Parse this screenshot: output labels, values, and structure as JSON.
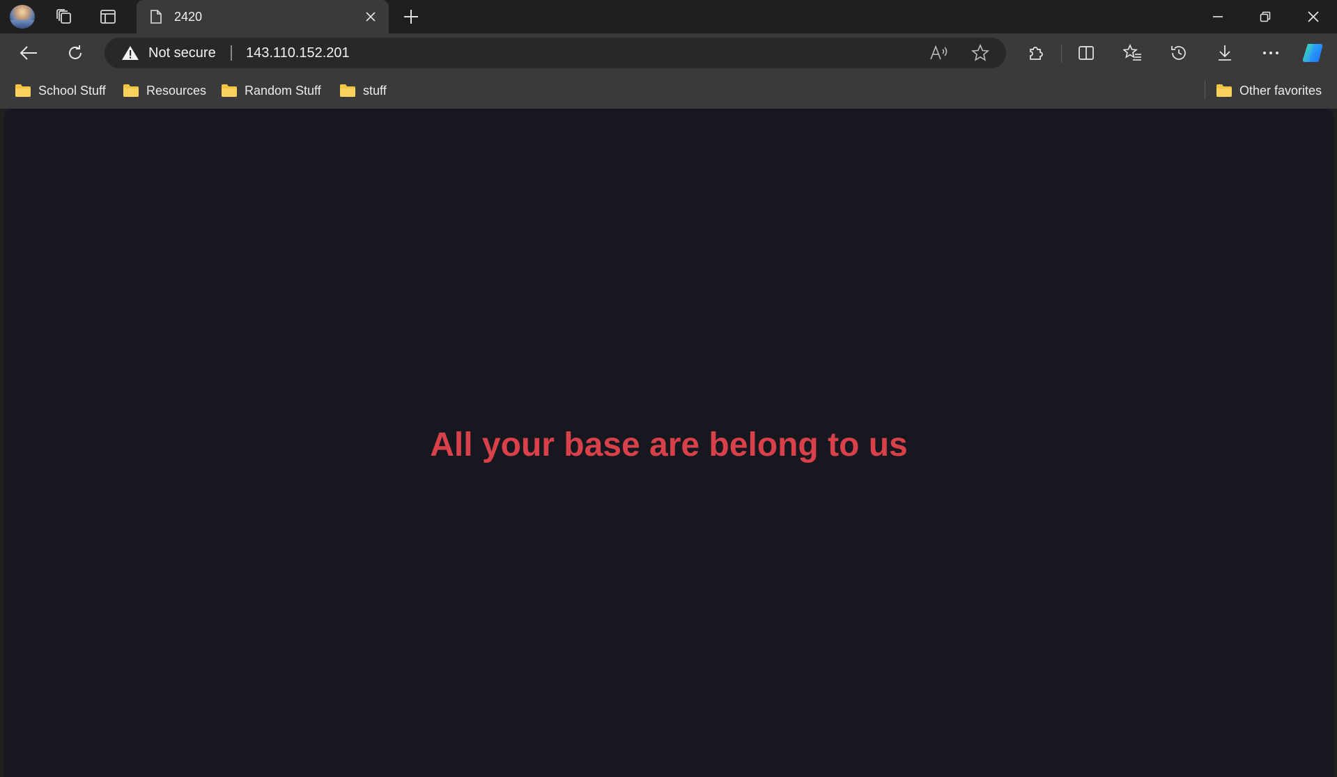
{
  "browser": {
    "tab": {
      "title": "2420"
    },
    "address_bar": {
      "security_label": "Not secure",
      "url": "143.110.152.201"
    },
    "favorites": [
      {
        "label": "School Stuff",
        "icon": "folder-icon"
      },
      {
        "label": "Resources",
        "icon": "folder-icon"
      },
      {
        "label": "Random Stuff",
        "icon": "folder-icon"
      },
      {
        "label": "stuff",
        "icon": "folder-icon"
      }
    ],
    "other_favorites": {
      "label": "Other favorites",
      "icon": "folder-icon"
    },
    "colors": {
      "chrome_dark": "#1f1f1f",
      "toolbar": "#3a3a3a",
      "folder": "#f4c542"
    }
  },
  "page": {
    "headline": "All your base are belong to us",
    "background_color": "#171720",
    "headline_color": "#d9414a"
  }
}
